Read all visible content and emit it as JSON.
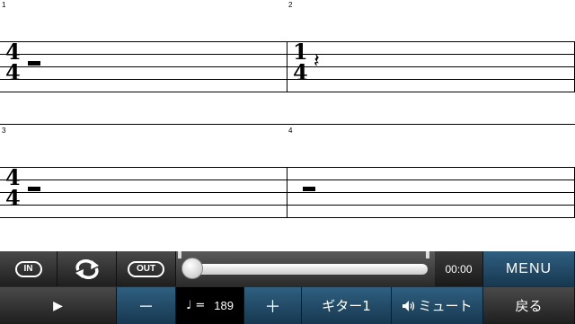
{
  "score": {
    "measures": [
      {
        "number": "1",
        "time_sig_top": "4",
        "time_sig_bottom": "4",
        "content": "whole-rest"
      },
      {
        "number": "2",
        "time_sig_top": "1",
        "time_sig_bottom": "4",
        "content": "quarter-rest"
      },
      {
        "number": "3",
        "time_sig_top": "4",
        "time_sig_bottom": "4",
        "content": "whole-rest"
      },
      {
        "number": "4",
        "time_sig_top": "",
        "time_sig_bottom": "",
        "content": "whole-rest"
      }
    ],
    "quarter_rest_glyph": "𝄽"
  },
  "toolbar": {
    "in_label": "IN",
    "loop_icon": "loop-icon",
    "out_label": "OUT",
    "playback_progress": 0,
    "time": "00:00",
    "menu_label": "MENU",
    "play_icon": "▶",
    "minus_label": "－",
    "tempo_note": "♩ =",
    "tempo_value": "189",
    "plus_label": "＋",
    "track_label": "ギター1",
    "mute_label": "ミュート",
    "mute_icon": "speaker-icon",
    "back_label": "戻る",
    "colors": {
      "accent_blue": "#2f5f80",
      "dark": "#2a2a2a"
    }
  }
}
